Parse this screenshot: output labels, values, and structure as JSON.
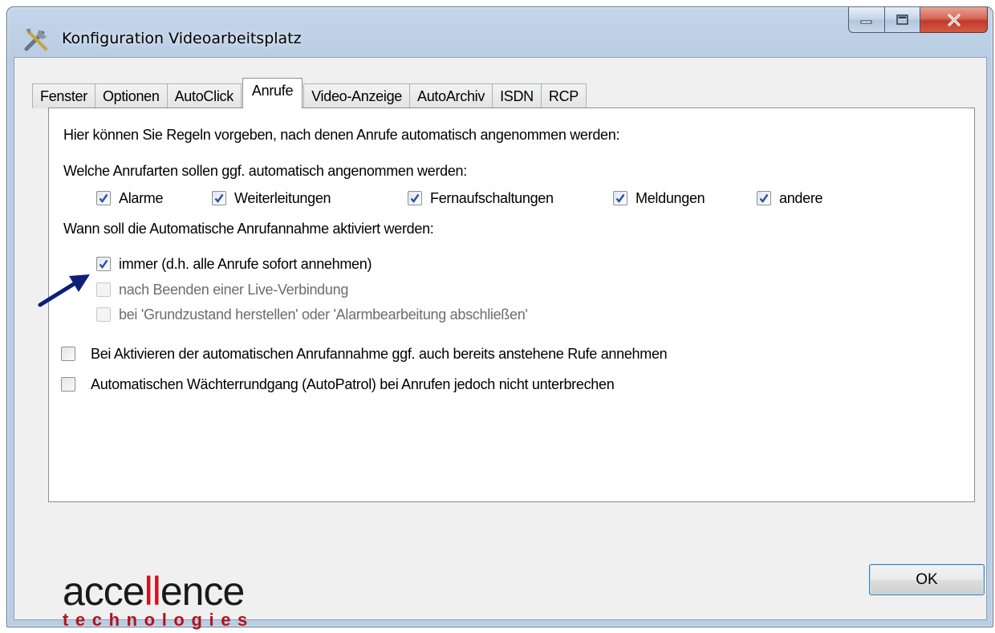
{
  "window": {
    "title": "Konfiguration Videoarbeitsplatz",
    "icon": "tools-icon"
  },
  "tabs": [
    {
      "label": "Fenster",
      "active": false
    },
    {
      "label": "Optionen",
      "active": false
    },
    {
      "label": "AutoClick",
      "active": false
    },
    {
      "label": "Anrufe",
      "active": true
    },
    {
      "label": "Video-Anzeige",
      "active": false
    },
    {
      "label": "AutoArchiv",
      "active": false
    },
    {
      "label": "ISDN",
      "active": false
    },
    {
      "label": "RCP",
      "active": false
    }
  ],
  "panel": {
    "intro": "Hier können Sie Regeln vorgeben, nach denen Anrufe automatisch angenommen werden:",
    "types_heading": "Welche Anrufarten sollen ggf. automatisch angenommen werden:",
    "types": [
      {
        "label": "Alarme",
        "checked": true
      },
      {
        "label": "Weiterleitungen",
        "checked": true
      },
      {
        "label": "Fernaufschaltungen",
        "checked": true
      },
      {
        "label": "Meldungen",
        "checked": true
      },
      {
        "label": "andere",
        "checked": true
      }
    ],
    "when_heading": "Wann soll die Automatische Anrufannahme aktiviert werden:",
    "when_options": [
      {
        "label": "immer (d.h. alle Anrufe sofort annehmen)",
        "checked": true,
        "enabled": true
      },
      {
        "label": "nach Beenden einer Live-Verbindung",
        "checked": false,
        "enabled": false
      },
      {
        "label": "bei 'Grundzustand herstellen' oder 'Alarmbearbeitung abschließen'",
        "checked": false,
        "enabled": false
      }
    ],
    "extra_options": [
      {
        "label": "Bei Aktivieren der automatischen Anrufannahme ggf. auch bereits anstehene Rufe annehmen",
        "checked": false
      },
      {
        "label": "Automatischen Wächterrundgang (AutoPatrol) bei Anrufen jedoch nicht unterbrechen",
        "checked": false
      }
    ]
  },
  "logo": {
    "part1": "acce",
    "part2": "ll",
    "part3": "ence",
    "tagline": "technologies"
  },
  "buttons": {
    "ok": "OK"
  },
  "colors": {
    "arrow": "#0d1f7a",
    "logo_red": "#d4111b",
    "checkmark": "#2b4fa8"
  }
}
